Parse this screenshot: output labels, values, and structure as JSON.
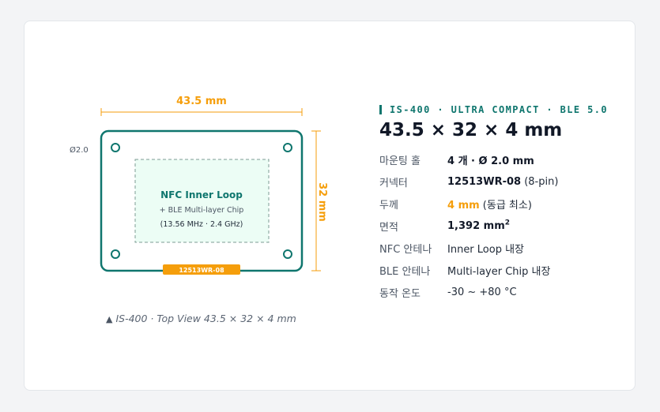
{
  "diagram": {
    "width_label": "43.5 mm",
    "height_label": "32 mm",
    "hole_label": "Ø2.0",
    "inner_title": "NFC Inner Loop",
    "inner_sub": "+ BLE Multi-layer Chip",
    "inner_freq": "(13.56 MHz · 2.4 GHz)",
    "connector_label": "12513WR-08",
    "colors": {
      "board": "#0f766e",
      "inner_fill": "#ecfdf5",
      "accent": "#f59e0b"
    },
    "caption_icon": "triangle-up-icon",
    "caption": "IS-400 · Top View 43.5 × 32 × 4 mm"
  },
  "spec": {
    "eyebrow": "IS-400 · ULTRA COMPACT · BLE 5.0",
    "headline": "43.5 × 32 × 4 mm",
    "rows": [
      {
        "key": "마운팅 홀",
        "value_bold": "4 개 · Ø 2.0 mm",
        "value": ""
      },
      {
        "key": "커넥터",
        "value_bold": "12513WR-08",
        "value": " (8-pin)"
      },
      {
        "key": "두께",
        "value_accent": "4 mm",
        "value": " (동급 최소)"
      },
      {
        "key": "면적",
        "value_bold": "1,392 mm",
        "sup": "2"
      },
      {
        "key": "NFC 안테나",
        "value": "Inner Loop 내장"
      },
      {
        "key": "BLE 안테나",
        "value": "Multi-layer Chip 내장"
      },
      {
        "key": "동작 온도",
        "value": "-30 ~ +80 °C"
      }
    ]
  }
}
